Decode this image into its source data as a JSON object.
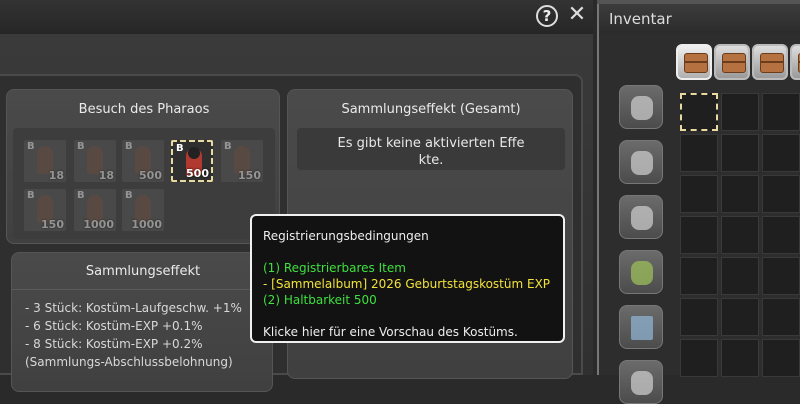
{
  "window": {
    "help_label": "?",
    "close_label": "✕"
  },
  "collection": {
    "title": "Besuch des Pharaos",
    "items": [
      {
        "badge": "B",
        "count": "18",
        "active": false
      },
      {
        "badge": "B",
        "count": "18",
        "active": false
      },
      {
        "badge": "B",
        "count": "500",
        "active": false
      },
      {
        "badge": "B",
        "count": "500",
        "active": true
      },
      {
        "badge": "B",
        "count": "150",
        "active": false
      },
      {
        "badge": "B",
        "count": "150",
        "active": false
      },
      {
        "badge": "B",
        "count": "1000",
        "active": false
      },
      {
        "badge": "B",
        "count": "1000",
        "active": false
      }
    ]
  },
  "effect": {
    "title": "Sammlungseffekt",
    "lines": [
      "- 3 Stück: Kostüm-Laufgeschw. +1%",
      "- 6 Stück: Kostüm-EXP +0.1%",
      "- 8 Stück: Kostüm-EXP +0.2%",
      "(Sammlungs-Abschlussbelohnung)"
    ]
  },
  "total_effect": {
    "title": "Sammlungseffekt (Gesamt)",
    "empty_line1": "Es gibt keine aktivierten Effe",
    "empty_line2": "kte."
  },
  "tooltip": {
    "heading": "Registrierungsbedingungen",
    "cond1": "(1) Registrierbares Item",
    "cond2": "- [Sammelalbum] 2026 Geburtstagskostüm EXP",
    "cond3": "(2) Haltbarkeit 500",
    "hint": "Klicke hier für eine Vorschau des Kostüms.",
    "colors": {
      "green": "#3fe03f",
      "yellow": "#f2e23a"
    }
  },
  "inventory": {
    "title": "Inventar",
    "tabs": [
      "chest-icon",
      "chest-icon",
      "chest-icon",
      "chest-icon"
    ],
    "side_icons": [
      "bag-icon",
      "pouch-icon",
      "quiver-icon",
      "golf-bag-icon",
      "cabinet-icon",
      "box-icon"
    ]
  }
}
